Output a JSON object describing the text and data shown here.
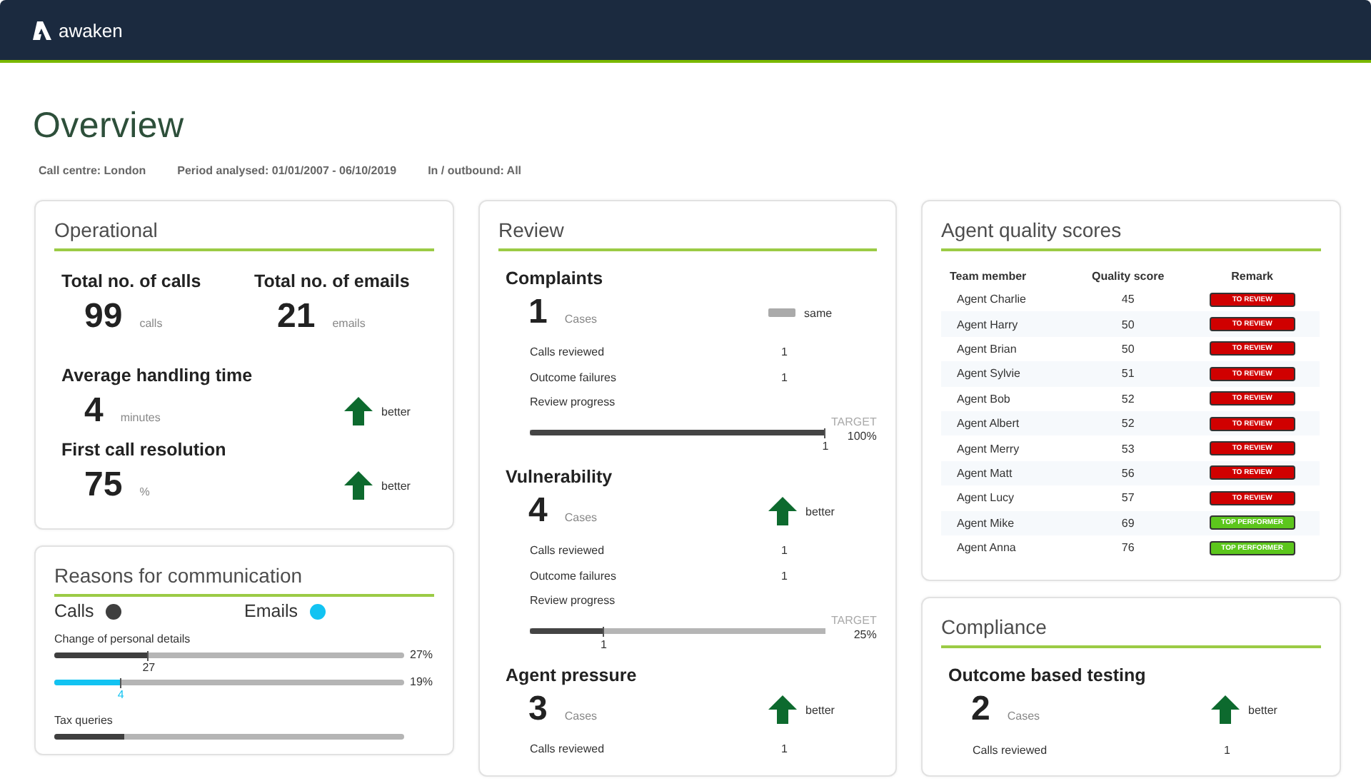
{
  "brand": {
    "name": "awaken"
  },
  "page": {
    "title": "Overview",
    "filters": [
      "Call centre: London",
      "Period analysed: 01/01/2007 - 06/10/2019",
      "In / outbound: All"
    ]
  },
  "operational": {
    "title": "Operational",
    "metrics": [
      {
        "label": "Total no. of calls",
        "value": "99",
        "unit": "calls"
      },
      {
        "label": "Total no. of emails",
        "value": "21",
        "unit": "emails"
      },
      {
        "label": "Average handling time",
        "value": "4",
        "unit": "minutes",
        "trend": {
          "kind": "up",
          "text": "better"
        }
      },
      {
        "label": "First call resolution",
        "value": "75",
        "unit": "%",
        "trend": {
          "kind": "up",
          "text": "better"
        }
      }
    ]
  },
  "reasons": {
    "title": "Reasons for communication",
    "legend": [
      {
        "label": "Calls",
        "color": "#3f3f3f"
      },
      {
        "label": "Emails",
        "color": "#12c3f2"
      }
    ],
    "items": [
      {
        "label": "Change of personal details",
        "bars": [
          {
            "level": 0.27,
            "percent": "27%",
            "marker": "27"
          },
          {
            "level": 0.19,
            "percent": "19%",
            "marker": "4"
          }
        ]
      },
      {
        "label": "Tax queries",
        "bars": [
          {
            "level": 0.2
          }
        ]
      }
    ]
  },
  "review": {
    "title": "Review",
    "sections": [
      {
        "title": "Complaints",
        "value": "1",
        "unit": "Cases",
        "trend": {
          "kind": "same",
          "text": "same"
        },
        "rows": [
          {
            "label": "Calls reviewed",
            "value": "1"
          },
          {
            "label": "Outcome failures",
            "value": "1"
          }
        ],
        "progress": {
          "label": "Review progress",
          "target_label": "TARGET",
          "target": "100%",
          "level": 1,
          "marker": "1"
        }
      },
      {
        "title": "Vulnerability",
        "value": "4",
        "unit": "Cases",
        "trend": {
          "kind": "up",
          "text": "better"
        },
        "rows": [
          {
            "label": "Calls reviewed",
            "value": "1"
          },
          {
            "label": "Outcome failures",
            "value": "1"
          }
        ],
        "progress": {
          "label": "Review progress",
          "target_label": "TARGET",
          "target": "25%",
          "level": 0.25,
          "marker": "1"
        }
      },
      {
        "title": "Agent pressure",
        "value": "3",
        "unit": "Cases",
        "trend": {
          "kind": "up",
          "text": "better"
        },
        "rows": [
          {
            "label": "Calls reviewed",
            "value": "1"
          }
        ]
      }
    ]
  },
  "agents": {
    "title": "Agent quality scores",
    "columns": [
      "Team member",
      "Quality score",
      "Remark"
    ],
    "rows": [
      {
        "name": "Agent Charlie",
        "score": "45",
        "remark": "TO REVIEW",
        "kind": "review"
      },
      {
        "name": "Agent Harry",
        "score": "50",
        "remark": "TO REVIEW",
        "kind": "review"
      },
      {
        "name": "Agent Brian",
        "score": "50",
        "remark": "TO REVIEW",
        "kind": "review"
      },
      {
        "name": "Agent Sylvie",
        "score": "51",
        "remark": "TO REVIEW",
        "kind": "review"
      },
      {
        "name": "Agent Bob",
        "score": "52",
        "remark": "TO REVIEW",
        "kind": "review"
      },
      {
        "name": "Agent Albert",
        "score": "52",
        "remark": "TO REVIEW",
        "kind": "review"
      },
      {
        "name": "Agent Merry",
        "score": "53",
        "remark": "TO REVIEW",
        "kind": "review"
      },
      {
        "name": "Agent Matt",
        "score": "56",
        "remark": "TO REVIEW",
        "kind": "review"
      },
      {
        "name": "Agent Lucy",
        "score": "57",
        "remark": "TO REVIEW",
        "kind": "review"
      },
      {
        "name": "Agent Mike",
        "score": "69",
        "remark": "TOP PERFORMER",
        "kind": "top"
      },
      {
        "name": "Agent Anna",
        "score": "76",
        "remark": "TOP PERFORMER",
        "kind": "top"
      }
    ]
  },
  "compliance": {
    "title": "Compliance",
    "sections": [
      {
        "title": "Outcome based testing",
        "value": "2",
        "unit": "Cases",
        "trend": {
          "kind": "up",
          "text": "better"
        },
        "rows": [
          {
            "label": "Calls reviewed",
            "value": "1"
          }
        ]
      }
    ]
  }
}
